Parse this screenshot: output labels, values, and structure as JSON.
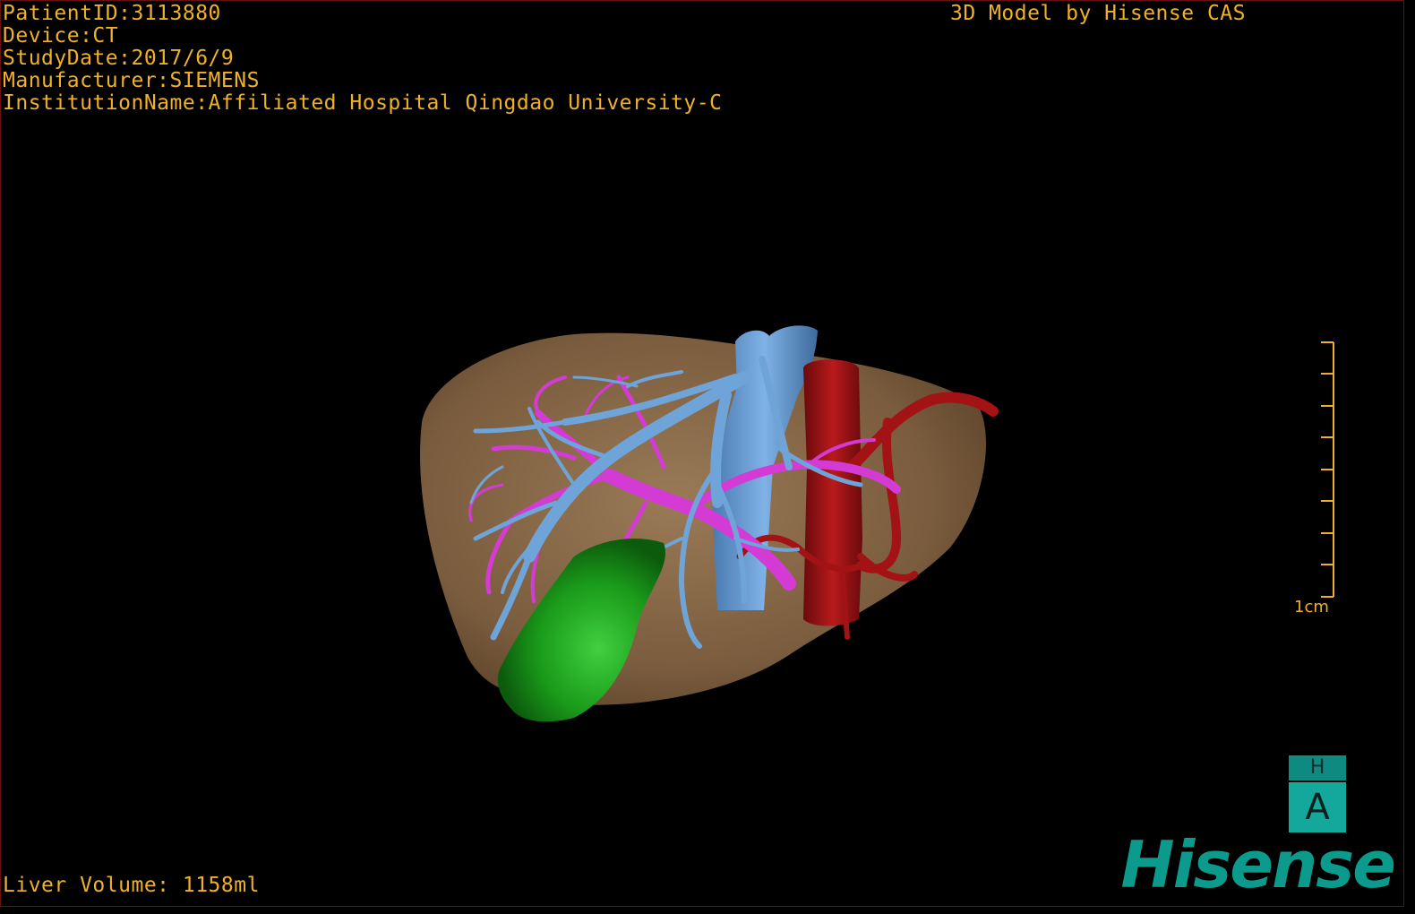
{
  "header_info": {
    "patient_id": "PatientID:3113880",
    "device": "Device:CT",
    "study_date": "StudyDate:2017/6/9",
    "manufacturer": "Manufacturer:SIEMENS",
    "institution": "InstitutionName:Affiliated Hospital Qingdao University-C"
  },
  "model_credit": "3D Model by Hisense CAS",
  "liver_volume": "Liver Volume: 1158ml",
  "scale_bar": {
    "label": "1cm"
  },
  "orientation": {
    "top": "H",
    "bottom": "A"
  },
  "logo": {
    "text": "Hisense"
  },
  "colors": {
    "text": "#f0b12a",
    "liver": "#8a6a48",
    "hepatic_vein": "#6fa4d8",
    "portal_vein": "#d43bd4",
    "artery": "#9a0f12",
    "gallbladder": "#1a8f1a",
    "logo": "#0b9a8c"
  },
  "structures": [
    "liver",
    "hepatic-vein",
    "portal-vein",
    "hepatic-artery",
    "aorta",
    "inferior-vena-cava",
    "gallbladder"
  ]
}
